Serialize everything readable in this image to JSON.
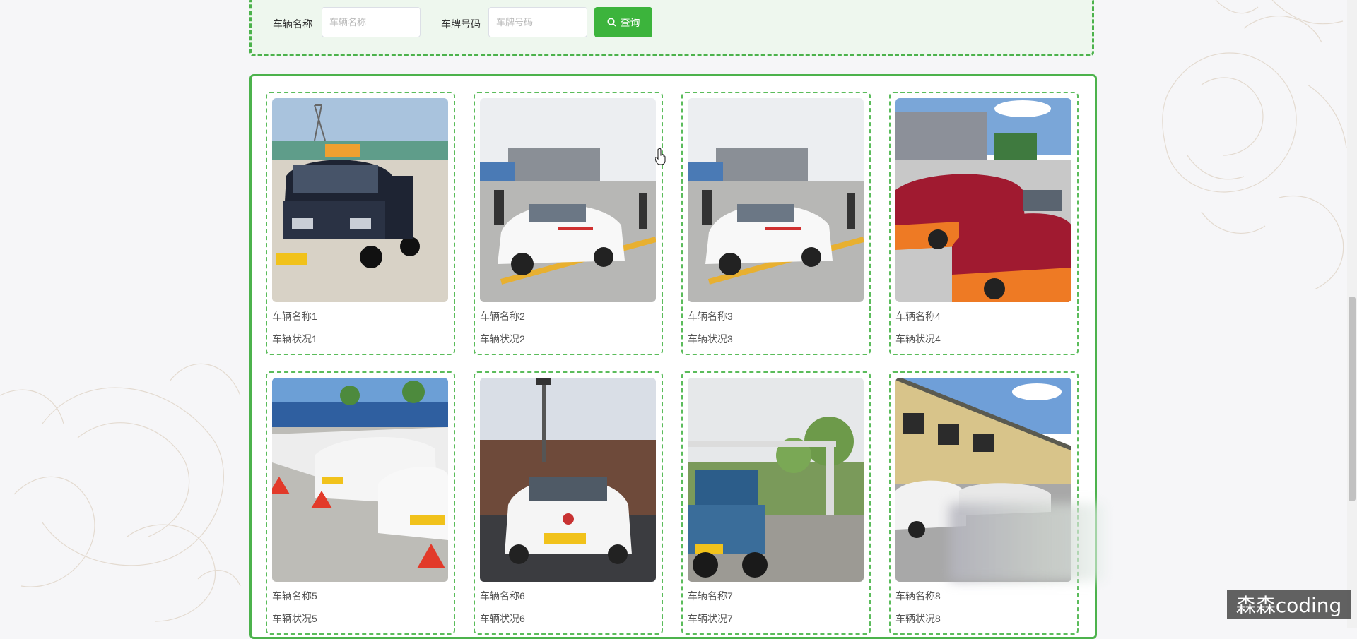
{
  "search": {
    "vehicle_name_label": "车辆名称",
    "vehicle_name_placeholder": "车辆名称",
    "vehicle_name_value": "",
    "plate_label": "车牌号码",
    "plate_placeholder": "车牌号码",
    "plate_value": "",
    "query_button_label": "查询",
    "query_icon": "search-icon"
  },
  "vehicles": [
    {
      "name": "车辆名称1",
      "status": "车辆状况1",
      "photo": "dark-sedan-with-roof-sign"
    },
    {
      "name": "车辆名称2",
      "status": "车辆状况2",
      "photo": "white-training-car"
    },
    {
      "name": "车辆名称3",
      "status": "车辆状况3",
      "photo": "white-training-car"
    },
    {
      "name": "车辆名称4",
      "status": "车辆状况4",
      "photo": "red-orange-cars"
    },
    {
      "name": "车辆名称5",
      "status": "车辆状况5",
      "photo": "white-cars-row-with-cones"
    },
    {
      "name": "车辆名称6",
      "status": "车辆状况6",
      "photo": "white-car-front"
    },
    {
      "name": "车辆名称7",
      "status": "车辆状况7",
      "photo": "blue-truck"
    },
    {
      "name": "车辆名称8",
      "status": "车辆状况8",
      "photo": "parking-lot-building"
    }
  ],
  "watermark": "森森coding",
  "colors": {
    "accent": "#3cb43c",
    "panel_border": "#4cb24c",
    "search_panel_bg": "#eef7ee",
    "page_bg": "#f6f6f8"
  }
}
